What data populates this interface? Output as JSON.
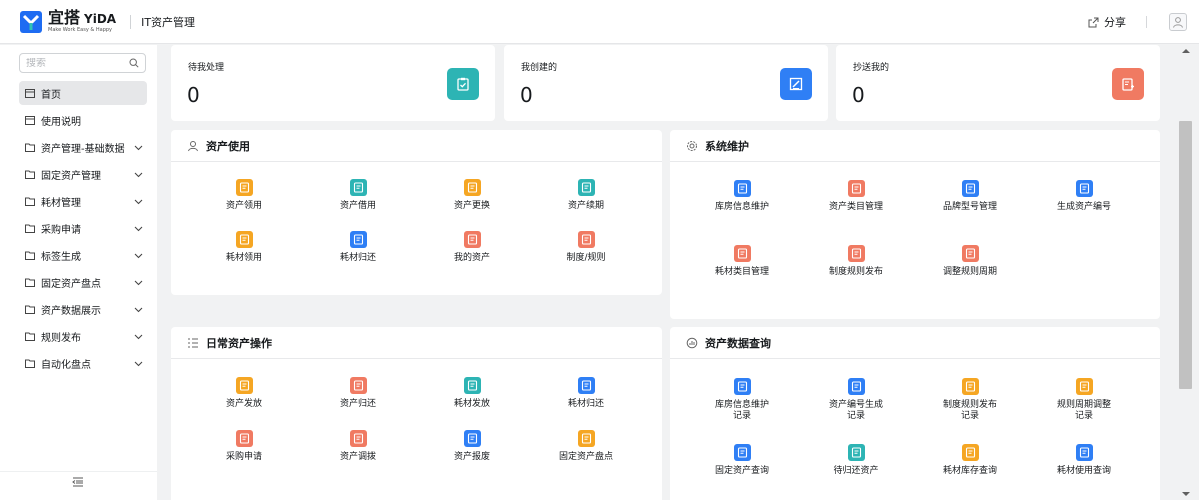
{
  "topbar": {
    "logo_main": "宜搭",
    "logo_en": "YiDA",
    "logo_sub": "Make Work Easy & Happy",
    "app_title": "IT资产管理",
    "share_label": "分享"
  },
  "sidebar": {
    "search_placeholder": "搜索",
    "items": [
      {
        "label": "首页",
        "icon": "page-icon",
        "active": true
      },
      {
        "label": "使用说明",
        "icon": "page-icon"
      },
      {
        "label": "资产管理-基础数据",
        "icon": "folder-icon",
        "expandable": true
      },
      {
        "label": "固定资产管理",
        "icon": "folder-icon",
        "expandable": true
      },
      {
        "label": "耗材管理",
        "icon": "folder-icon",
        "expandable": true
      },
      {
        "label": "采购申请",
        "icon": "folder-icon",
        "expandable": true
      },
      {
        "label": "标签生成",
        "icon": "folder-icon",
        "expandable": true
      },
      {
        "label": "固定资产盘点",
        "icon": "folder-icon",
        "expandable": true
      },
      {
        "label": "资产数据展示",
        "icon": "folder-icon",
        "expandable": true
      },
      {
        "label": "规则发布",
        "icon": "folder-icon",
        "expandable": true
      },
      {
        "label": "自动化盘点",
        "icon": "folder-icon",
        "expandable": true
      }
    ]
  },
  "stats": [
    {
      "label": "待我处理",
      "value": "0",
      "icon": "clipboard-check-icon",
      "color": "#2db4b4"
    },
    {
      "label": "我创建的",
      "value": "0",
      "icon": "edit-document-icon",
      "color": "#2f7ff5"
    },
    {
      "label": "抄送我的",
      "value": "0",
      "icon": "document-share-icon",
      "color": "#f07a62"
    }
  ],
  "sections": {
    "asset_use": {
      "title": "资产使用",
      "icon": "user-icon",
      "tiles": [
        {
          "label": "资产领用",
          "color": "#f5a623"
        },
        {
          "label": "资产借用",
          "color": "#2db4b4"
        },
        {
          "label": "资产更换",
          "color": "#f5a623"
        },
        {
          "label": "资产续期",
          "color": "#2db4b4"
        },
        {
          "label": "耗材领用",
          "color": "#f5a623"
        },
        {
          "label": "耗材归还",
          "color": "#2f7ff5"
        },
        {
          "label": "我的资产",
          "color": "#f07a62"
        },
        {
          "label": "制度/规则",
          "color": "#f07a62"
        }
      ]
    },
    "system": {
      "title": "系统维护",
      "icon": "gear-icon",
      "tiles": [
        {
          "label": "库房信息维护",
          "color": "#2f7ff5"
        },
        {
          "label": "资产类目管理",
          "color": "#f07a62"
        },
        {
          "label": "品牌型号管理",
          "color": "#2f7ff5"
        },
        {
          "label": "生成资产编号",
          "color": "#2f7ff5"
        },
        {
          "label": "耗材类目管理",
          "color": "#f07a62"
        },
        {
          "label": "制度规则发布",
          "color": "#f07a62"
        },
        {
          "label": "调整规则周期",
          "color": "#f07a62"
        }
      ]
    },
    "daily": {
      "title": "日常资产操作",
      "icon": "list-icon",
      "tiles": [
        {
          "label": "资产发放",
          "color": "#f5a623"
        },
        {
          "label": "资产归还",
          "color": "#f07a62"
        },
        {
          "label": "耗材发放",
          "color": "#2db4b4"
        },
        {
          "label": "耗材归还",
          "color": "#2f7ff5"
        },
        {
          "label": "采购申请",
          "color": "#f07a62"
        },
        {
          "label": "资产调拨",
          "color": "#f07a62"
        },
        {
          "label": "资产报废",
          "color": "#2f7ff5"
        },
        {
          "label": "固定资产盘点",
          "color": "#f5a623"
        }
      ]
    },
    "query": {
      "title": "资产数据查询",
      "icon": "chart-icon",
      "tiles": [
        {
          "label": "库房信息维护记录",
          "color": "#2f7ff5"
        },
        {
          "label": "资产编号生成记录",
          "color": "#2f7ff5"
        },
        {
          "label": "制度规则发布记录",
          "color": "#f5a623"
        },
        {
          "label": "规则周期调整记录",
          "color": "#f5a623"
        },
        {
          "label": "固定资产查询",
          "color": "#2f7ff5"
        },
        {
          "label": "待归还资产",
          "color": "#2db4b4"
        },
        {
          "label": "耗材库存查询",
          "color": "#f5a623"
        },
        {
          "label": "耗材使用查询",
          "color": "#2f7ff5"
        }
      ]
    }
  }
}
